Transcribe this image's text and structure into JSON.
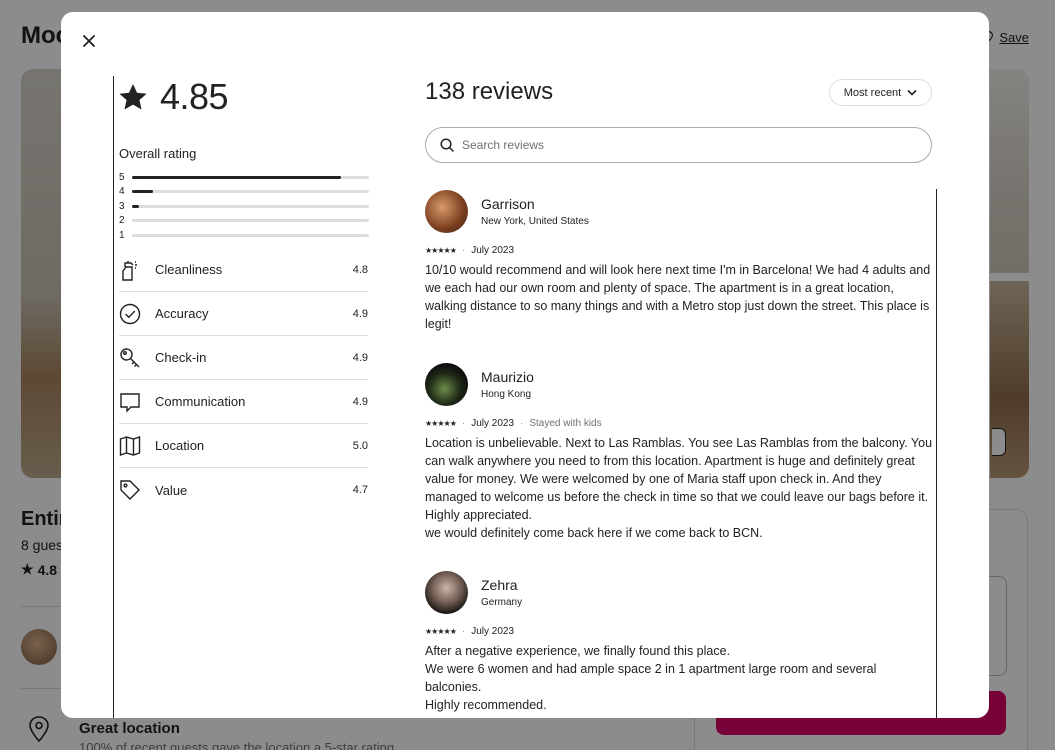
{
  "background": {
    "title": "Moc",
    "save_label": "Save",
    "listing_title": "Entir",
    "guests": "8 gues",
    "rating": "4.8",
    "location_title": "Great location",
    "location_sub": "100% of recent guests gave the location a 5-star rating."
  },
  "modal": {
    "overall": {
      "score": "4.85",
      "label": "Overall rating",
      "distribution": [
        {
          "star": "5",
          "fraction": 0.88
        },
        {
          "star": "4",
          "fraction": 0.09
        },
        {
          "star": "3",
          "fraction": 0.03
        },
        {
          "star": "2",
          "fraction": 0.0
        },
        {
          "star": "1",
          "fraction": 0.0
        }
      ]
    },
    "categories": [
      {
        "icon": "spray-bottle-icon",
        "name": "Cleanliness",
        "value": "4.8"
      },
      {
        "icon": "check-circle-icon",
        "name": "Accuracy",
        "value": "4.9"
      },
      {
        "icon": "key-icon",
        "name": "Check-in",
        "value": "4.9"
      },
      {
        "icon": "chat-bubble-icon",
        "name": "Communication",
        "value": "4.9"
      },
      {
        "icon": "map-icon",
        "name": "Location",
        "value": "5.0"
      },
      {
        "icon": "tag-icon",
        "name": "Value",
        "value": "4.7"
      }
    ],
    "reviews_header": {
      "count": "138 reviews",
      "sort_label": "Most recent",
      "search_placeholder": "Search reviews"
    },
    "reviews": [
      {
        "name": "Garrison",
        "location": "New York, United States",
        "stars": "★★★★★",
        "date": "July 2023",
        "tag": "",
        "text": "10/10 would recommend and will look here next time I'm in Barcelona! We had 4 adults and we each had our own room and plenty of space. The apartment is in a great location, walking distance to so many things and with a Metro stop just down the street. This place is legit!"
      },
      {
        "name": "Maurizio",
        "location": "Hong Kong",
        "stars": "★★★★★",
        "date": "July 2023",
        "tag": "Stayed with kids",
        "text": "Location is unbelievable. Next to Las Ramblas. You see Las Ramblas from the balcony. You can walk anywhere you need to from this location. Apartment is huge and definitely great value for money. We were welcomed by one of Maria staff upon check in. And they managed to welcome us before the check in time so that we could leave our bags before it. Highly appreciated.\nwe would definitely come back here if we come back to BCN."
      },
      {
        "name": "Zehra",
        "location": "Germany",
        "stars": "★★★★★",
        "date": "July 2023",
        "tag": "",
        "text": "After a negative experience, we finally found this place.\nWe were 6 women and had ample space 2 in 1 apartment large room and several balconies.\nHighly recommended."
      }
    ]
  }
}
